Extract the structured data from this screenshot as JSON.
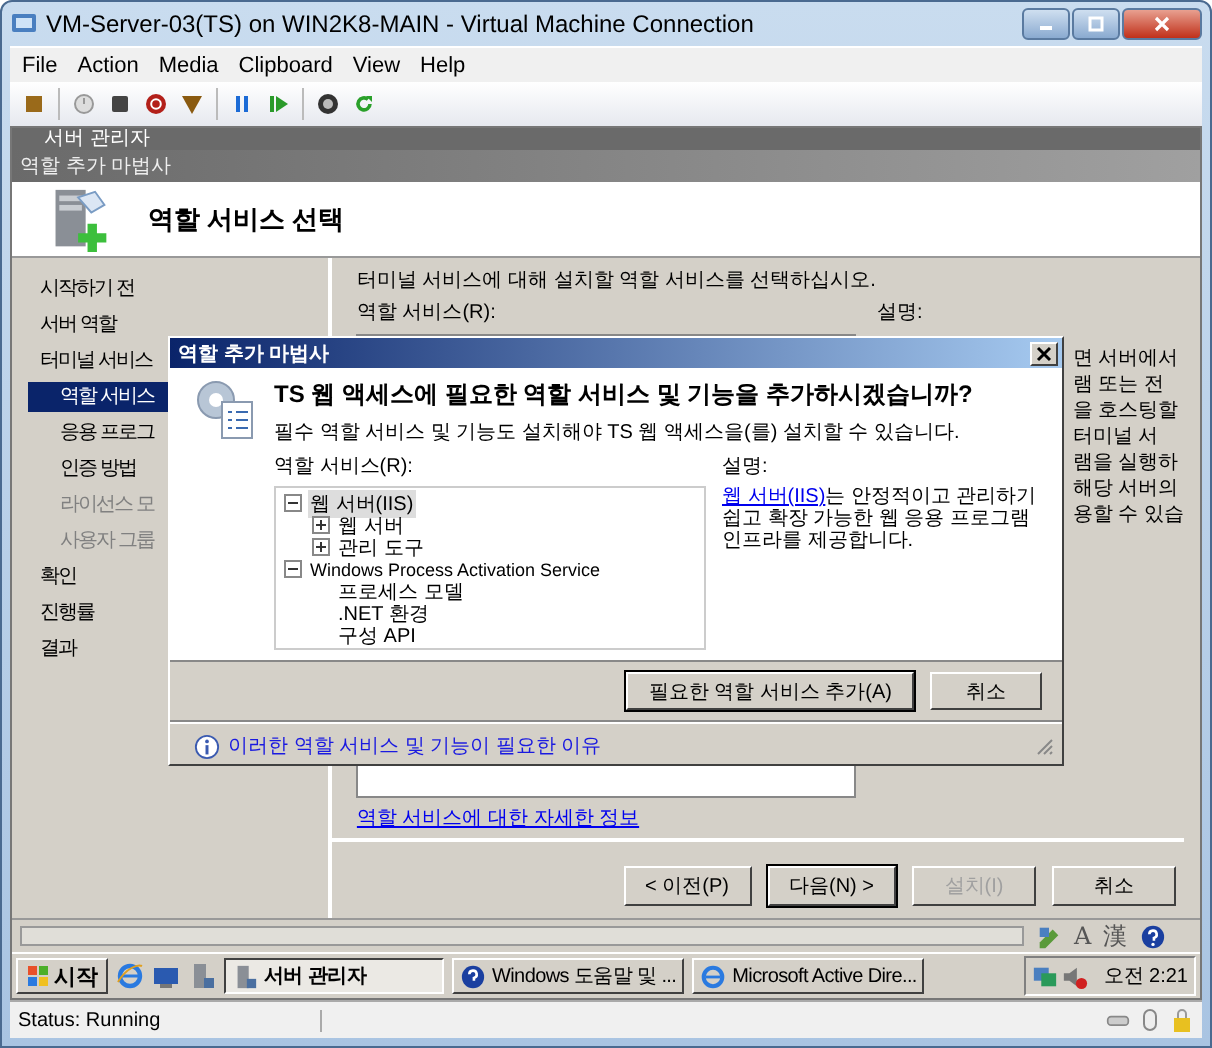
{
  "window": {
    "title": "VM-Server-03(TS) on WIN2K8-MAIN - Virtual Machine Connection"
  },
  "menu": [
    "File",
    "Action",
    "Media",
    "Clipboard",
    "View",
    "Help"
  ],
  "server_manager": {
    "title": "서버 관리자"
  },
  "wizard": {
    "title": "역할 추가 마법사",
    "heading": "역할 서비스 선택",
    "nav": [
      {
        "label": "시작하기 전",
        "selected": false,
        "disabled": false
      },
      {
        "label": "서버 역할",
        "selected": false,
        "disabled": false
      },
      {
        "label": "터미널 서비스",
        "selected": false,
        "disabled": false,
        "children": [
          {
            "label": "역할 서비스",
            "selected": true,
            "disabled": false
          },
          {
            "label": "응용 프로그",
            "selected": false,
            "disabled": false
          },
          {
            "label": "인증 방법",
            "selected": false,
            "disabled": false
          },
          {
            "label": "라이선스 모",
            "selected": false,
            "disabled": true
          },
          {
            "label": "사용자 그룹",
            "selected": false,
            "disabled": true
          }
        ]
      },
      {
        "label": "확인",
        "selected": false,
        "disabled": false
      },
      {
        "label": "진행률",
        "selected": false,
        "disabled": false
      },
      {
        "label": "결과",
        "selected": false,
        "disabled": false
      }
    ],
    "intro": "터미널 서비스에 대해 설치할 역할 서비스를 선택하십시오.",
    "list_label": "역할 서비스(R):",
    "description_label": "설명:",
    "description_fragments": [
      "면 서버에서",
      "램 또는 전",
      "을 호스팅할",
      "터미널 서",
      "램을 실행하",
      "해당 서버의",
      "용할 수 있습"
    ],
    "more_info_link": "역할 서비스에 대한 자세한 정보",
    "buttons": [
      {
        "label": "< 이전(P)",
        "disabled": false,
        "default": false
      },
      {
        "label": "다음(N) >",
        "disabled": false,
        "default": true
      },
      {
        "label": "설치(I)",
        "disabled": true,
        "default": false
      },
      {
        "label": "취소",
        "disabled": false,
        "default": false
      }
    ]
  },
  "dialog": {
    "title": "역할 추가 마법사",
    "question": "TS 웹 액세스에 필요한 역할 서비스 및 기능을 추가하시겠습니까?",
    "note": "필수 역할 서비스 및 기능도 설치해야 TS 웹 액세스을(를) 설치할 수 있습니다.",
    "tree_label": "역할 서비스(R):",
    "tree": [
      {
        "label": "웹 서버(IIS)",
        "expanded": true,
        "selected": true,
        "children": [
          {
            "label": "웹 서버",
            "expanded": false,
            "selected": false
          },
          {
            "label": "관리 도구",
            "expanded": false,
            "selected": false
          }
        ]
      },
      {
        "label": "Windows Process Activation Service",
        "expanded": true,
        "selected": false,
        "children": [
          {
            "label": "프로세스 모델",
            "selected": false
          },
          {
            "label": ".NET 환경",
            "selected": false
          },
          {
            "label": "구성 API",
            "selected": false
          }
        ]
      }
    ],
    "description_label": "설명:",
    "description_link": "웹 서버(IIS)",
    "description": "는 안정적이고 관리하기 쉽고 확장 가능한 웹 응용 프로그램 인프라를 제공합니다.",
    "buttons": [
      {
        "label": "필요한 역할 서비스 추가(A)",
        "default": true
      },
      {
        "label": "취소",
        "default": false
      }
    ],
    "help_link": "이러한 역할 서비스 및 기능이 필요한 이유"
  },
  "taskbar": {
    "start": "시작",
    "tasks": [
      {
        "label": "서버 관리자",
        "selected": true,
        "kind": "server"
      },
      {
        "label": "Windows 도움말 및 ...",
        "selected": false,
        "kind": "help"
      },
      {
        "label": "Microsoft Active Dire...",
        "selected": false,
        "kind": "browser"
      }
    ],
    "clock": "오전 2:21"
  },
  "language_bar": {
    "input_mode": "A",
    "hanja": "漢"
  },
  "status_bar": {
    "text": "Status: Running"
  }
}
